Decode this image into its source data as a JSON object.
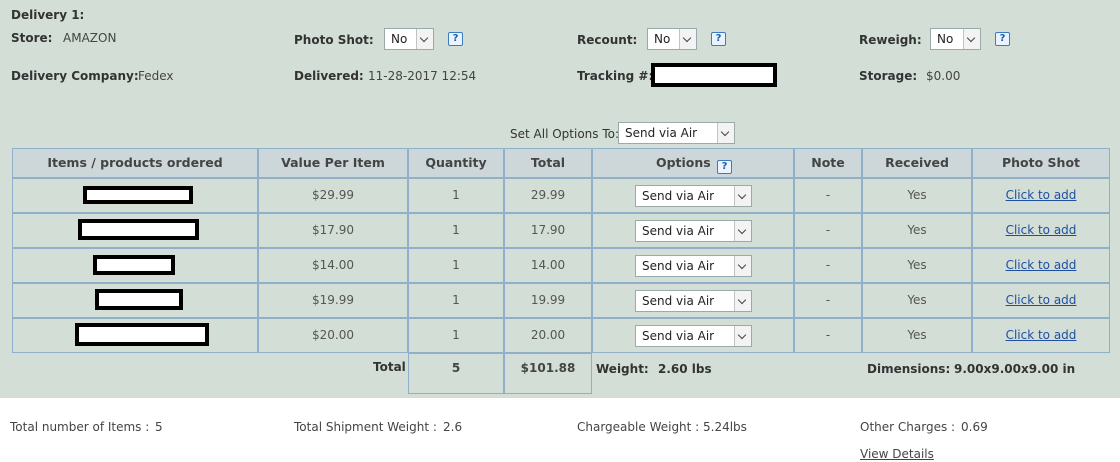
{
  "delivery": {
    "title": "Delivery 1:",
    "store_label": "Store:",
    "store_value": "AMAZON",
    "photo_shot_label": "Photo Shot:",
    "photo_shot_value": "No",
    "recount_label": "Recount:",
    "recount_value": "No",
    "reweigh_label": "Reweigh:",
    "reweigh_value": "No",
    "company_label": "Delivery Company:",
    "company_value": "Fedex",
    "delivered_label": "Delivered:",
    "delivered_value": "11-28-2017 12:54",
    "tracking_label": "Tracking #:",
    "storage_label": "Storage:",
    "storage_value": "$0.00",
    "help_glyph": "?"
  },
  "set_all": {
    "label": "Set All Options To:",
    "value": "Send via Air"
  },
  "table": {
    "headers": [
      "Items / products ordered",
      "Value Per Item",
      "Quantity",
      "Total",
      "Options",
      "Note",
      "Received",
      "Photo Shot"
    ],
    "rows": [
      {
        "value": "$29.99",
        "qty": "1",
        "total": "29.99",
        "option": "Send via Air",
        "note": "-",
        "received": "Yes",
        "photo": "Click to add"
      },
      {
        "value": "$17.90",
        "qty": "1",
        "total": "17.90",
        "option": "Send via Air",
        "note": "-",
        "received": "Yes",
        "photo": "Click to add"
      },
      {
        "value": "$14.00",
        "qty": "1",
        "total": "14.00",
        "option": "Send via Air",
        "note": "-",
        "received": "Yes",
        "photo": "Click to add"
      },
      {
        "value": "$19.99",
        "qty": "1",
        "total": "19.99",
        "option": "Send via Air",
        "note": "-",
        "received": "Yes",
        "photo": "Click to add"
      },
      {
        "value": "$20.00",
        "qty": "1",
        "total": "20.00",
        "option": "Send via Air",
        "note": "-",
        "received": "Yes",
        "photo": "Click to add"
      }
    ],
    "total_label": "Total",
    "total_qty": "5",
    "total_value": "$101.88",
    "weight_label": "Weight:",
    "weight_value": "2.60 lbs",
    "dimensions_label": "Dimensions:",
    "dimensions_value": "9.00x9.00x9.00 in"
  },
  "summary": {
    "items_label": "Total number of Items :",
    "items_value": "5",
    "weight_label": "Total Shipment Weight :",
    "weight_value": "2.6",
    "chargeable_label": "Chargeable Weight :",
    "chargeable_value": "5.24lbs",
    "other_label": "Other Charges :",
    "other_value": "0.69",
    "view_details": "View Details"
  },
  "colors": {
    "panel_bg": "#d3ded7",
    "header_bg": "#cdd7d9",
    "border": "#8fb0c8",
    "link": "#1f4fa0"
  },
  "icons": {
    "help": "help-icon",
    "dropdown": "chevron-down-icon"
  }
}
